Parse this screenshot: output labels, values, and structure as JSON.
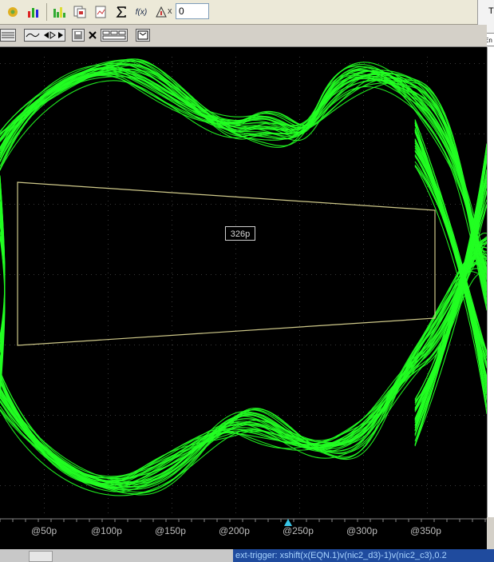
{
  "toolbar": {
    "x_label": "x",
    "x_value": "0",
    "fx_label": "f(x)"
  },
  "side_panel": {
    "title": "T",
    "button_label": "En"
  },
  "plot": {
    "annotation": "326p",
    "x_ticks": [
      "@50p",
      "@100p",
      "@150p",
      "@200p",
      "@250p",
      "@300p",
      "@350p"
    ],
    "trace_color": "#22ff22",
    "mask_color": "#cfc98a"
  },
  "status": {
    "text": "ext-trigger: xshift(x(EQN.1)v(nic2_d3)-1)v(nic2_c3),0.2"
  }
}
